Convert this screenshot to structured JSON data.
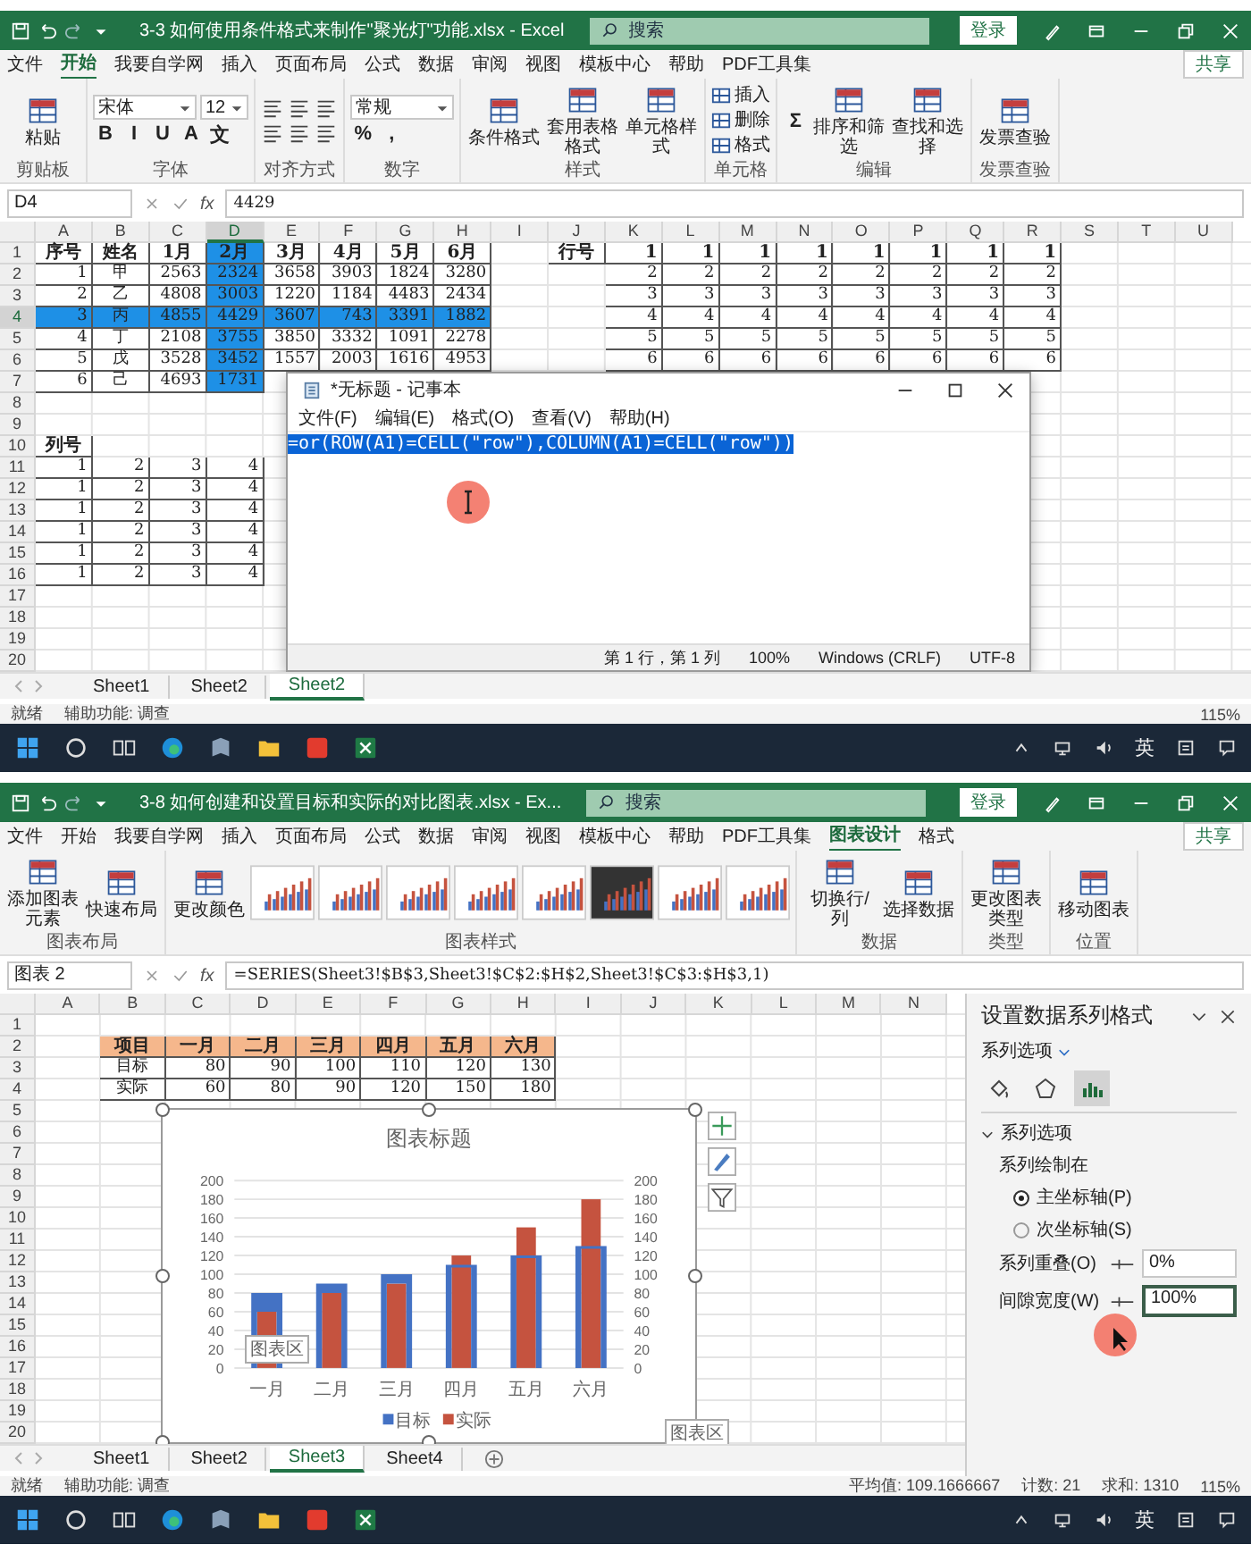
{
  "windows": [
    {
      "title_bar": {
        "title": "3-3 如何使用条件格式来制作\"聚光灯\"功能.xlsx - Excel",
        "search_placeholder": "搜索",
        "login_button": "登录"
      },
      "menu_tabs": [
        {
          "label": "文件",
          "selected": false
        },
        {
          "label": "开始",
          "selected": true
        },
        {
          "label": "我要自学网",
          "selected": false
        },
        {
          "label": "插入",
          "selected": false
        },
        {
          "label": "页面布局",
          "selected": false
        },
        {
          "label": "公式",
          "selected": false
        },
        {
          "label": "数据",
          "selected": false
        },
        {
          "label": "审阅",
          "selected": false
        },
        {
          "label": "视图",
          "selected": false
        },
        {
          "label": "模板中心",
          "selected": false
        },
        {
          "label": "帮助",
          "selected": false
        },
        {
          "label": "PDF工具集",
          "selected": false
        }
      ],
      "share_button": "共享",
      "ribbon": [
        {
          "label": "剪贴板",
          "tiers": [
            [
              {
                "kind": "large",
                "label": "粘贴"
              }
            ]
          ]
        },
        {
          "label": "字体",
          "tiers": [
            [
              {
                "kind": "select",
                "label": "宋体"
              },
              {
                "kind": "select",
                "label": "12"
              }
            ],
            [
              {
                "kind": "glyph",
                "label": "B"
              },
              {
                "kind": "glyph",
                "label": "I"
              },
              {
                "kind": "glyph",
                "label": "U"
              },
              {
                "kind": "glyph",
                "label": "A"
              },
              {
                "kind": "glyph",
                "label": "文"
              }
            ]
          ]
        },
        {
          "label": "对齐方式",
          "tiers": [
            [
              {
                "kind": "lines"
              },
              {
                "kind": "lines"
              },
              {
                "kind": "lines"
              }
            ],
            [
              {
                "kind": "lines"
              },
              {
                "kind": "lines"
              },
              {
                "kind": "lines"
              }
            ]
          ]
        },
        {
          "label": "数字",
          "tiers": [
            [
              {
                "kind": "select",
                "label": "常规"
              }
            ],
            [
              {
                "kind": "glyph",
                "label": "%"
              },
              {
                "kind": "glyph",
                "label": ","
              }
            ]
          ]
        },
        {
          "label": "样式",
          "tiers": [
            [
              {
                "kind": "large",
                "label": "条件格式"
              },
              {
                "kind": "large",
                "label": "套用表格格式"
              },
              {
                "kind": "large",
                "label": "单元格样式"
              }
            ]
          ]
        },
        {
          "label": "单元格",
          "tiers": [
            [
              {
                "kind": "small",
                "label": "插入"
              }
            ],
            [
              {
                "kind": "small",
                "label": "删除"
              }
            ],
            [
              {
                "kind": "small",
                "label": "格式"
              }
            ]
          ]
        },
        {
          "label": "编辑",
          "tiers": [
            [
              {
                "kind": "glyph",
                "label": "Σ"
              },
              {
                "kind": "large",
                "label": "排序和筛选"
              },
              {
                "kind": "large",
                "label": "查找和选择"
              }
            ]
          ]
        },
        {
          "label": "发票查验",
          "tiers": [
            [
              {
                "kind": "large",
                "label": "发票查验"
              }
            ]
          ]
        }
      ],
      "formula_bar": {
        "name_box": "D4",
        "fx": "fx",
        "formula": "4429"
      },
      "grid": {
        "columns": [
          {
            "label": "A",
            "selected": false
          },
          {
            "label": "B",
            "selected": false
          },
          {
            "label": "C",
            "selected": false
          },
          {
            "label": "D",
            "selected": true
          },
          {
            "label": "E",
            "selected": false
          },
          {
            "label": "F",
            "selected": false
          },
          {
            "label": "G",
            "selected": false
          },
          {
            "label": "H",
            "selected": false
          },
          {
            "label": "I",
            "selected": false
          },
          {
            "label": "J",
            "selected": false
          },
          {
            "label": "K",
            "selected": false
          },
          {
            "label": "L",
            "selected": false
          },
          {
            "label": "M",
            "selected": false
          },
          {
            "label": "N",
            "selected": false
          },
          {
            "label": "O",
            "selected": false
          },
          {
            "label": "P",
            "selected": false
          },
          {
            "label": "Q",
            "selected": false
          },
          {
            "label": "R",
            "selected": false
          },
          {
            "label": "S",
            "selected": false
          },
          {
            "label": "T",
            "selected": false
          },
          {
            "label": "U",
            "selected": false
          }
        ],
        "rows": [
          {
            "header": "1",
            "selected": false,
            "kind": "header",
            "cells": [
              "序号",
              "姓名",
              "1月",
              "2月",
              "3月",
              "4月",
              "5月",
              "6月",
              "",
              "行号",
              "1",
              "1",
              "1",
              "1",
              "1",
              "1",
              "1",
              "1"
            ],
            "highlighted_cells": [
              false,
              false,
              false,
              true,
              false,
              false,
              false,
              false
            ]
          },
          {
            "header": "2",
            "selected": false,
            "kind": "table",
            "cells": [
              "1",
              "甲",
              "2563",
              "2324",
              "3658",
              "3903",
              "1824",
              "3280",
              "",
              "",
              "2",
              "2",
              "2",
              "2",
              "2",
              "2",
              "2",
              "2"
            ],
            "highlighted_cells": [
              false,
              false,
              false,
              true,
              false,
              false,
              false,
              false
            ]
          },
          {
            "header": "3",
            "selected": false,
            "kind": "table",
            "cells": [
              "2",
              "乙",
              "4808",
              "3003",
              "1220",
              "1184",
              "4483",
              "2434",
              "",
              "",
              "3",
              "3",
              "3",
              "3",
              "3",
              "3",
              "3",
              "3"
            ],
            "highlighted_cells": [
              false,
              false,
              false,
              true,
              false,
              false,
              false,
              false
            ]
          },
          {
            "header": "4",
            "selected": true,
            "kind": "table",
            "cells": [
              "3",
              "丙",
              "4855",
              "4429",
              "3607",
              "743",
              "3391",
              "1882",
              "",
              "",
              "4",
              "4",
              "4",
              "4",
              "4",
              "4",
              "4",
              "4"
            ],
            "highlighted_cells": [
              true,
              true,
              true,
              true,
              true,
              true,
              true,
              true
            ]
          },
          {
            "header": "5",
            "selected": false,
            "kind": "table",
            "cells": [
              "4",
              "丁",
              "2108",
              "3755",
              "3850",
              "3332",
              "1091",
              "2278",
              "",
              "",
              "5",
              "5",
              "5",
              "5",
              "5",
              "5",
              "5",
              "5"
            ],
            "highlighted_cells": [
              false,
              false,
              false,
              true,
              false,
              false,
              false,
              false
            ]
          },
          {
            "header": "6",
            "selected": false,
            "kind": "table",
            "cells": [
              "5",
              "戊",
              "3528",
              "3452",
              "1557",
              "2003",
              "1616",
              "4953",
              "",
              "",
              "6",
              "6",
              "6",
              "6",
              "6",
              "6",
              "6",
              "6"
            ],
            "highlighted_cells": [
              false,
              false,
              false,
              true,
              false,
              false,
              false,
              false
            ]
          },
          {
            "header": "7",
            "selected": false,
            "kind": "table",
            "cells": [
              "6",
              "己",
              "4693",
              "1731"
            ],
            "highlighted_cells": [
              false,
              false,
              false,
              true
            ]
          },
          {
            "header": "8",
            "selected": false,
            "kind": "plain",
            "cells": []
          },
          {
            "header": "9",
            "selected": false,
            "kind": "plain",
            "cells": []
          },
          {
            "header": "10",
            "selected": false,
            "kind": "header",
            "cells": [
              "列号"
            ]
          },
          {
            "header": "11",
            "selected": false,
            "kind": "table",
            "cells": [
              "1",
              "2",
              "3",
              "4"
            ]
          },
          {
            "header": "12",
            "selected": false,
            "kind": "table",
            "cells": [
              "1",
              "2",
              "3",
              "4"
            ]
          },
          {
            "header": "13",
            "selected": false,
            "kind": "table",
            "cells": [
              "1",
              "2",
              "3",
              "4"
            ]
          },
          {
            "header": "14",
            "selected": false,
            "kind": "table",
            "cells": [
              "1",
              "2",
              "3",
              "4"
            ]
          },
          {
            "header": "15",
            "selected": false,
            "kind": "table",
            "cells": [
              "1",
              "2",
              "3",
              "4"
            ]
          },
          {
            "header": "16",
            "selected": false,
            "kind": "table",
            "cells": [
              "1",
              "2",
              "3",
              "4"
            ]
          },
          {
            "header": "17",
            "selected": false,
            "kind": "plain",
            "cells": []
          },
          {
            "header": "18",
            "selected": false,
            "kind": "plain",
            "cells": []
          },
          {
            "header": "19",
            "selected": false,
            "kind": "plain",
            "cells": []
          },
          {
            "header": "20",
            "selected": false,
            "kind": "plain",
            "cells": []
          }
        ]
      },
      "sheet_tabs": [
        {
          "label": "Sheet1",
          "selected": false
        },
        {
          "label": "Sheet2",
          "selected": false
        },
        {
          "label": "Sheet2",
          "selected": true
        }
      ],
      "notepad": {
        "title": "*无标题 - 记事本",
        "menu": [
          "文件(F)",
          "编辑(E)",
          "格式(O)",
          "查看(V)",
          "帮助(H)"
        ],
        "text": "=or(ROW(A1)=CELL(\"row\"),COLUMN(A1)=CELL(\"row\"))",
        "text_selected": true,
        "status": [
          "第 1 行，第 1 列",
          "100%",
          "Windows (CRLF)",
          "UTF-8"
        ]
      },
      "status_bar": {
        "items": [
          "就绪",
          "辅助功能: 调查"
        ],
        "zoom": "115%"
      },
      "taskbar": {
        "ime": "英"
      }
    },
    {
      "title_bar": {
        "title": "3-8 如何创建和设置目标和实际的对比图表.xlsx - Ex...",
        "search_placeholder": "搜索",
        "login_button": "登录"
      },
      "menu_tabs": [
        {
          "label": "文件",
          "selected": false
        },
        {
          "label": "开始",
          "selected": false
        },
        {
          "label": "我要自学网",
          "selected": false
        },
        {
          "label": "插入",
          "selected": false
        },
        {
          "label": "页面布局",
          "selected": false
        },
        {
          "label": "公式",
          "selected": false
        },
        {
          "label": "数据",
          "selected": false
        },
        {
          "label": "审阅",
          "selected": false
        },
        {
          "label": "视图",
          "selected": false
        },
        {
          "label": "模板中心",
          "selected": false
        },
        {
          "label": "帮助",
          "selected": false
        },
        {
          "label": "PDF工具集",
          "selected": false
        },
        {
          "label": "图表设计",
          "selected": true
        },
        {
          "label": "格式",
          "selected": false
        }
      ],
      "share_button": "共享",
      "ribbon": [
        {
          "label": "图表布局",
          "tiers": [
            [
              {
                "kind": "large",
                "label": "添加图表元素"
              },
              {
                "kind": "large",
                "label": "快速布局"
              }
            ]
          ]
        },
        {
          "label": "图表样式",
          "tiers": [
            [
              {
                "kind": "large",
                "label": "更改颜色"
              },
              {
                "kind": "thumb-light"
              },
              {
                "kind": "thumb-light"
              },
              {
                "kind": "thumb-light"
              },
              {
                "kind": "thumb-light"
              },
              {
                "kind": "thumb-light"
              },
              {
                "kind": "thumb-dark"
              },
              {
                "kind": "thumb-light"
              },
              {
                "kind": "thumb-light"
              }
            ]
          ]
        },
        {
          "label": "数据",
          "tiers": [
            [
              {
                "kind": "large",
                "label": "切换行/列"
              },
              {
                "kind": "large",
                "label": "选择数据"
              }
            ]
          ]
        },
        {
          "label": "类型",
          "tiers": [
            [
              {
                "kind": "large",
                "label": "更改图表类型"
              }
            ]
          ]
        },
        {
          "label": "位置",
          "tiers": [
            [
              {
                "kind": "large",
                "label": "移动图表"
              }
            ]
          ]
        }
      ],
      "formula_bar": {
        "name_box": "图表 2",
        "fx": "fx",
        "formula": "=SERIES(Sheet3!$B$3,Sheet3!$C$2:$H$2,Sheet3!$C$3:$H$3,1)"
      },
      "grid": {
        "columns": [
          {
            "label": "A",
            "selected": false
          },
          {
            "label": "B",
            "selected": false
          },
          {
            "label": "C",
            "selected": false
          },
          {
            "label": "D",
            "selected": false
          },
          {
            "label": "E",
            "selected": false
          },
          {
            "label": "F",
            "selected": false
          },
          {
            "label": "G",
            "selected": false
          },
          {
            "label": "H",
            "selected": false
          },
          {
            "label": "I",
            "selected": false
          },
          {
            "label": "J",
            "selected": false
          },
          {
            "label": "K",
            "selected": false
          },
          {
            "label": "L",
            "selected": false
          },
          {
            "label": "M",
            "selected": false
          },
          {
            "label": "N",
            "selected": false
          }
        ],
        "rows": [
          {
            "header": "1",
            "selected": false,
            "kind": "plain",
            "cells": []
          },
          {
            "header": "2",
            "selected": false,
            "kind": "header-filled",
            "cells": [
              "",
              "项目",
              "一月",
              "二月",
              "三月",
              "四月",
              "五月",
              "六月"
            ]
          },
          {
            "header": "3",
            "selected": false,
            "kind": "table",
            "cells": [
              "",
              "目标",
              "80",
              "90",
              "100",
              "110",
              "120",
              "130"
            ]
          },
          {
            "header": "4",
            "selected": false,
            "kind": "table",
            "cells": [
              "",
              "实际",
              "60",
              "80",
              "90",
              "120",
              "150",
              "180"
            ]
          },
          {
            "header": "5",
            "selected": false,
            "kind": "plain",
            "cells": []
          },
          {
            "header": "6",
            "selected": false,
            "kind": "plain",
            "cells": []
          },
          {
            "header": "7",
            "selected": false,
            "kind": "plain",
            "cells": []
          },
          {
            "header": "8",
            "selected": false,
            "kind": "plain",
            "cells": []
          },
          {
            "header": "9",
            "selected": false,
            "kind": "plain",
            "cells": []
          },
          {
            "header": "10",
            "selected": false,
            "kind": "plain",
            "cells": []
          },
          {
            "header": "11",
            "selected": false,
            "kind": "plain",
            "cells": []
          },
          {
            "header": "12",
            "selected": false,
            "kind": "plain",
            "cells": []
          },
          {
            "header": "13",
            "selected": false,
            "kind": "plain",
            "cells": []
          },
          {
            "header": "14",
            "selected": false,
            "kind": "plain",
            "cells": []
          },
          {
            "header": "15",
            "selected": false,
            "kind": "plain",
            "cells": []
          },
          {
            "header": "16",
            "selected": false,
            "kind": "plain",
            "cells": []
          },
          {
            "header": "17",
            "selected": false,
            "kind": "plain",
            "cells": []
          },
          {
            "header": "18",
            "selected": false,
            "kind": "plain",
            "cells": []
          },
          {
            "header": "19",
            "selected": false,
            "kind": "plain",
            "cells": []
          },
          {
            "header": "20",
            "selected": false,
            "kind": "plain",
            "cells": []
          }
        ]
      },
      "chart": {
        "chart_data": {
          "type": "bar",
          "title": "图表标题",
          "categories": [
            "一月",
            "二月",
            "三月",
            "四月",
            "五月",
            "六月"
          ],
          "series": [
            {
              "name": "目标",
              "color": "#4472c4",
              "values": [
                80,
                90,
                100,
                110,
                120,
                130
              ]
            },
            {
              "name": "实际",
              "color": "#c5533f",
              "values": [
                60,
                80,
                90,
                120,
                150,
                180
              ]
            }
          ],
          "ylim": [
            0,
            200
          ],
          "yticks": [
            0,
            20,
            40,
            60,
            80,
            100,
            120,
            140,
            160,
            180,
            200
          ],
          "y2lim": [
            0,
            200
          ],
          "y2ticks": [
            0,
            20,
            40,
            60,
            80,
            100,
            120,
            140,
            160,
            180,
            200
          ],
          "grid": true,
          "legend": "bottom"
        },
        "tooltips": [
          "图表区",
          "图表区"
        ]
      },
      "sheet_tabs": [
        {
          "label": "Sheet1",
          "selected": false
        },
        {
          "label": "Sheet2",
          "selected": false
        },
        {
          "label": "Sheet3",
          "selected": true
        },
        {
          "label": "Sheet4",
          "selected": false
        }
      ],
      "format_pane": {
        "title": "设置数据系列格式",
        "options_dropdown": "系列选项",
        "tabs": [
          {
            "selected": false
          },
          {
            "selected": false
          },
          {
            "selected": true
          }
        ],
        "section": {
          "label": "系列选项",
          "expanded": true
        },
        "plot_on_label": "系列绘制在",
        "radios": [
          {
            "label": "主坐标轴(P)",
            "selected": true
          },
          {
            "label": "次坐标轴(S)",
            "selected": false
          }
        ],
        "fields": [
          {
            "label": "系列重叠(O)",
            "value": "0%",
            "focused": false
          },
          {
            "label": "间隙宽度(W)",
            "value": "100%",
            "focused": true
          }
        ]
      },
      "status_bar": {
        "items": [
          "就绪",
          "辅助功能: 调查"
        ],
        "stats": [
          "平均值: 109.1666667",
          "计数: 21",
          "求和: 1310"
        ],
        "zoom": "115%"
      },
      "taskbar": {
        "ime": "英"
      }
    }
  ]
}
